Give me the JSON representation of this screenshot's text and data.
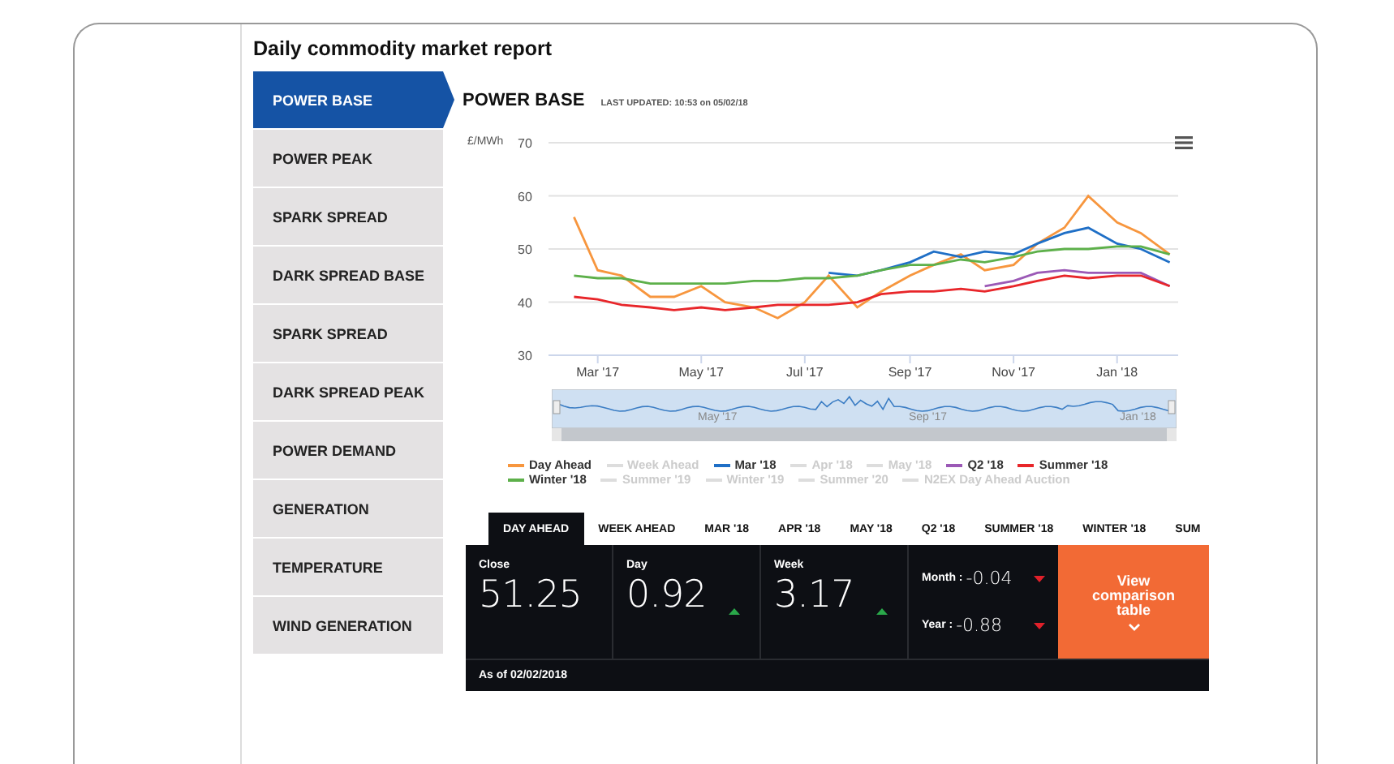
{
  "page_title": "Daily commodity market report",
  "sidebar": {
    "items": [
      {
        "label": "POWER BASE",
        "selected": true
      },
      {
        "label": "POWER PEAK",
        "selected": false
      },
      {
        "label": "SPARK SPREAD",
        "selected": false
      },
      {
        "label": "DARK SPREAD BASE",
        "selected": false
      },
      {
        "label": "SPARK SPREAD",
        "selected": false
      },
      {
        "label": "DARK SPREAD PEAK",
        "selected": false
      },
      {
        "label": "POWER DEMAND",
        "selected": false
      },
      {
        "label": "GENERATION",
        "selected": false
      },
      {
        "label": "TEMPERATURE",
        "selected": false
      },
      {
        "label": "WIND GENERATION",
        "selected": false
      }
    ]
  },
  "header": {
    "title": "POWER BASE",
    "last_updated": "LAST UPDATED: 10:53 on 05/02/18"
  },
  "chart": {
    "chart_data": {
      "type": "line",
      "ylabel": "£/MWh",
      "grid": "y",
      "xlim": [
        "2017-01-31",
        "2018-02-06"
      ],
      "x": [
        "2017-02-15",
        "2017-03-01",
        "2017-03-15",
        "2017-04-01",
        "2017-04-15",
        "2017-05-01",
        "2017-05-15",
        "2017-06-01",
        "2017-06-15",
        "2017-07-01",
        "2017-07-15",
        "2017-08-01",
        "2017-08-15",
        "2017-09-01",
        "2017-09-15",
        "2017-10-01",
        "2017-10-15",
        "2017-11-01",
        "2017-11-15",
        "2017-12-01",
        "2017-12-15",
        "2018-01-01",
        "2018-01-15",
        "2018-02-01"
      ],
      "ylim": [
        30,
        70
      ],
      "yticks": [
        30,
        40,
        50,
        60,
        70
      ],
      "xticks": [
        {
          "value": "2017-03-01",
          "label": "Mar '17"
        },
        {
          "value": "2017-05-01",
          "label": "May '17"
        },
        {
          "value": "2017-07-01",
          "label": "Jul '17"
        },
        {
          "value": "2017-09-01",
          "label": "Sep '17"
        },
        {
          "value": "2017-11-01",
          "label": "Nov '17"
        },
        {
          "value": "2018-01-01",
          "label": "Jan '18"
        }
      ],
      "series": [
        {
          "name": "Day Ahead",
          "color": "#f7963e",
          "values": [
            56,
            46,
            45,
            41,
            41,
            43,
            40,
            39,
            37,
            40,
            45,
            39,
            42,
            45,
            47,
            49,
            46,
            47,
            51,
            54,
            60,
            55,
            53,
            49
          ]
        },
        {
          "name": "Mar '18",
          "color": "#1f6fc6",
          "values": [
            null,
            null,
            null,
            null,
            null,
            null,
            null,
            null,
            null,
            null,
            45.5,
            45,
            46,
            47.5,
            49.5,
            48.5,
            49.5,
            49,
            51,
            53,
            54,
            51,
            50,
            47.5
          ]
        },
        {
          "name": "Q2 '18",
          "color": "#9b59b6",
          "values": [
            null,
            null,
            null,
            null,
            null,
            null,
            null,
            null,
            null,
            null,
            null,
            null,
            null,
            null,
            null,
            null,
            43,
            44,
            45.5,
            46,
            45.5,
            45.5,
            45.5,
            43
          ]
        },
        {
          "name": "Summer '18",
          "color": "#e8262a",
          "values": [
            41,
            40.5,
            39.5,
            39,
            38.5,
            39,
            38.5,
            39,
            39.5,
            39.5,
            39.5,
            40,
            41.5,
            42,
            42,
            42.5,
            42,
            43,
            44,
            45,
            44.5,
            45,
            45,
            43
          ]
        },
        {
          "name": "Winter '18",
          "color": "#5db04a",
          "values": [
            45,
            44.5,
            44.5,
            43.5,
            43.5,
            43.5,
            43.5,
            44,
            44,
            44.5,
            44.5,
            45,
            46,
            47,
            47,
            48,
            47.5,
            48.5,
            49.5,
            50,
            50,
            50.5,
            50.5,
            49
          ]
        }
      ]
    },
    "navigator_labels": [
      "May '17",
      "Sep '17",
      "Jan '18"
    ]
  },
  "legend": [
    {
      "kind": "series"
    },
    {
      "kind": "hidden",
      "label": "Week Ahead"
    },
    {
      "kind": "series"
    },
    {
      "kind": "hidden",
      "label": "Apr '18"
    },
    {
      "kind": "hidden",
      "label": "May '18"
    },
    {
      "kind": "series"
    },
    {
      "kind": "series"
    },
    {
      "kind": "series"
    },
    {
      "kind": "hidden",
      "label": "Summer '19"
    },
    {
      "kind": "hidden",
      "label": "Winter '19"
    },
    {
      "kind": "hidden",
      "label": "Summer '20"
    },
    {
      "kind": "hidden",
      "label": "N2EX Day Ahead Auction"
    }
  ],
  "tabs": [
    {
      "label": "DAY AHEAD",
      "selected": true
    },
    {
      "label": "WEEK AHEAD",
      "selected": false
    },
    {
      "label": "MAR '18",
      "selected": false
    },
    {
      "label": "APR '18",
      "selected": false
    },
    {
      "label": "MAY '18",
      "selected": false
    },
    {
      "label": "Q2 '18",
      "selected": false
    },
    {
      "label": "SUMMER '18",
      "selected": false
    },
    {
      "label": "WINTER '18",
      "selected": false
    },
    {
      "label": "SUM",
      "selected": false
    }
  ],
  "stats": {
    "close": {
      "label": "Close",
      "value": "51.25"
    },
    "changes": [
      {
        "label": "Day",
        "value": "0.92",
        "rising": true
      },
      {
        "label": "Week",
        "value": "3.17",
        "rising": true
      }
    ],
    "periods": [
      {
        "label": "Month :",
        "value": "-0.04",
        "rising": false
      },
      {
        "label": "Year :",
        "value": "-0.88",
        "rising": false
      }
    ],
    "comparison_button": "View comparison table",
    "as_of": "As of 02/02/2018"
  }
}
